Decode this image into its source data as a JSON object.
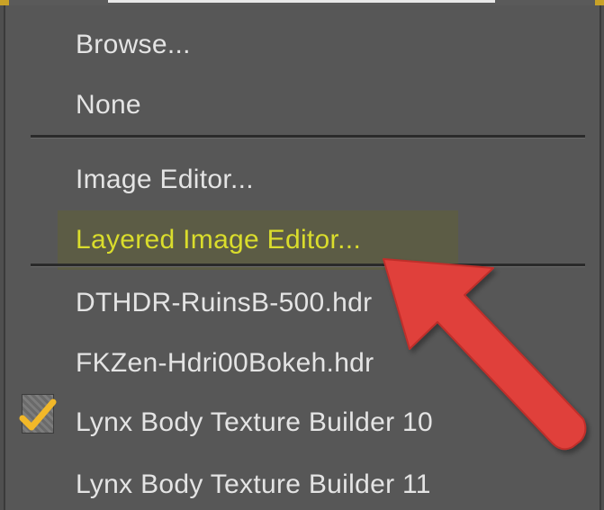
{
  "menu": {
    "items": [
      {
        "label": "Browse..."
      },
      {
        "label": "None"
      },
      {
        "label": "Image Editor..."
      },
      {
        "label": "Layered Image Editor..."
      },
      {
        "label": "DTHDR-RuinsB-500.hdr"
      },
      {
        "label": "FKZen-Hdri00Bokeh.hdr"
      },
      {
        "label": "Lynx Body Texture Builder 10",
        "checked": true
      },
      {
        "label": "Lynx Body Texture Builder 11"
      }
    ],
    "highlighted_item": "Layered Image Editor..."
  },
  "colors": {
    "menu_background": "#575757",
    "text": "#e4e4e4",
    "highlight_text": "#dadd2c",
    "checkmark": "#f2b829",
    "annotation_arrow": "#e0403a"
  },
  "icons": {
    "checkmark": "checkmark-icon",
    "annotation": "red-arrow-icon"
  }
}
